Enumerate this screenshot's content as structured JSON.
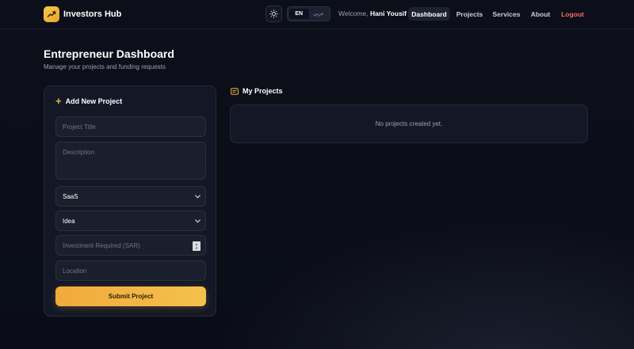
{
  "nav": {
    "brand": "Investors Hub",
    "lang_en": "EN",
    "lang_ar": "عربي",
    "welcome_prefix": "Welcome,",
    "user_name": "Hani Yousif",
    "links": {
      "dashboard": "Dashboard",
      "projects": "Projects",
      "services": "Services",
      "about": "About",
      "logout": "Logout"
    }
  },
  "header": {
    "title": "Entrepreneur Dashboard",
    "subtitle": "Manage your projects and funding requests"
  },
  "form": {
    "title": "Add New Project",
    "project_title_placeholder": "Project Title",
    "description_placeholder": "Description",
    "category_value": "SaaS",
    "stage_value": "Idea",
    "investment_placeholder": "Investment Required (SAR)",
    "location_placeholder": "Location",
    "submit_label": "Submit Project"
  },
  "projects": {
    "title": "My Projects",
    "empty_message": "No projects created yet."
  },
  "colors": {
    "accent": "#f2b43f",
    "logout": "#f26b5b",
    "background": "#0c0f1a"
  }
}
